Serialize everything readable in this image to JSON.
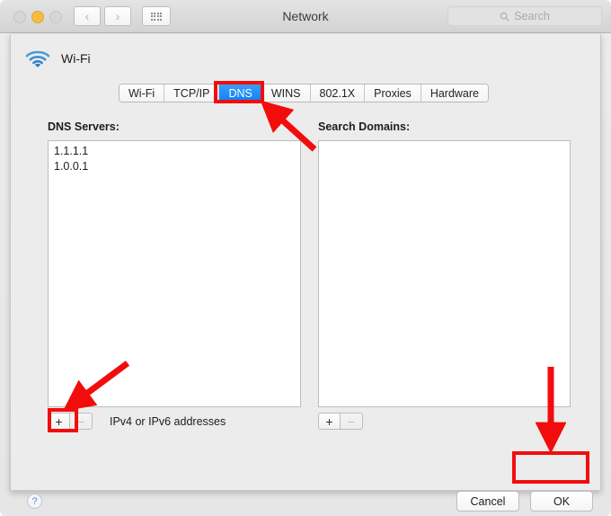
{
  "window": {
    "title": "Network",
    "traffic_lights": [
      "close",
      "minimize",
      "zoom"
    ],
    "nav_back": "‹",
    "nav_forward": "›",
    "grid_button": "show-all-icon",
    "search": {
      "placeholder": "Search",
      "value": "",
      "icon": "search-icon"
    }
  },
  "sheet": {
    "service": {
      "icon": "wifi-icon",
      "label": "Wi-Fi"
    },
    "tabs": [
      {
        "label": "Wi-Fi",
        "selected": false
      },
      {
        "label": "TCP/IP",
        "selected": false
      },
      {
        "label": "DNS",
        "selected": true
      },
      {
        "label": "WINS",
        "selected": false
      },
      {
        "label": "802.1X",
        "selected": false
      },
      {
        "label": "Proxies",
        "selected": false
      },
      {
        "label": "Hardware",
        "selected": false
      }
    ],
    "dns_servers": {
      "label": "DNS Servers:",
      "items": [
        "1.1.1.1",
        "1.0.0.1"
      ],
      "add_label": "+",
      "remove_label": "−",
      "hint": "IPv4 or IPv6 addresses"
    },
    "search_domains": {
      "label": "Search Domains:",
      "items": [],
      "add_label": "+",
      "remove_label": "−"
    },
    "footer": {
      "help_label": "?",
      "cancel_label": "Cancel",
      "ok_label": "OK"
    }
  },
  "annotations": {
    "color": "#f20d0d",
    "boxes": [
      {
        "target": "dns-tab"
      },
      {
        "target": "dns-add-button"
      },
      {
        "target": "ok-button"
      }
    ],
    "arrows": [
      {
        "target": "dns-tab",
        "direction": "up-left"
      },
      {
        "target": "dns-add-button",
        "direction": "down-left"
      },
      {
        "target": "ok-button",
        "direction": "down"
      }
    ]
  },
  "colors": {
    "accent_blue": "#1080f7",
    "annotation_red": "#f20d0d",
    "wifi_icon_blue": "#3d8fd1",
    "window_bg": "#ececec"
  }
}
